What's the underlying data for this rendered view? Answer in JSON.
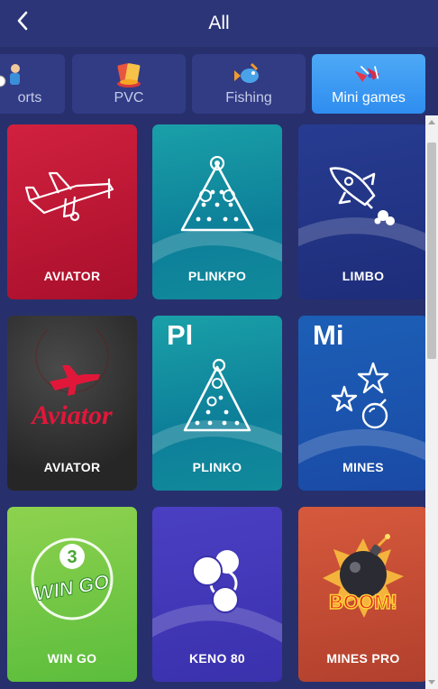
{
  "header": {
    "title": "All"
  },
  "tabs": [
    {
      "label": "orts",
      "icon": "sports-icon"
    },
    {
      "label": "PVC",
      "icon": "cards-chips-icon"
    },
    {
      "label": "Fishing",
      "icon": "fish-icon"
    },
    {
      "label": "Mini games",
      "icon": "planes-icon",
      "active": true
    }
  ],
  "games": [
    {
      "name": "AVIATOR",
      "icon": "plane-icon",
      "theme": "red"
    },
    {
      "name": "PLINKPO",
      "icon": "plinko-triangle-icon",
      "theme": "teal"
    },
    {
      "name": "LIMBO",
      "icon": "rocket-icon",
      "theme": "navy"
    },
    {
      "name": "AVIATOR",
      "icon": "aviator-logo-icon",
      "logo_text": "Aviator",
      "theme": "dark"
    },
    {
      "name": "PLINKO",
      "icon": "plinko-triangle-icon",
      "big": "Pl",
      "theme": "teal"
    },
    {
      "name": "MINES",
      "icon": "stars-bomb-icon",
      "big": "Mi",
      "theme": "blue"
    },
    {
      "name": "WIN GO",
      "icon": "wingo-ball-icon",
      "logo_number": "3",
      "logo_text": "WIN GO",
      "theme": "green"
    },
    {
      "name": "KENO 80",
      "icon": "keno-balls-icon",
      "theme": "purple"
    },
    {
      "name": "MINES PRO",
      "icon": "bomb-icon",
      "logo_text": "BOOM!",
      "theme": "orange"
    }
  ],
  "colors": {
    "background": "#27306d",
    "header": "#2c3577",
    "tab": "#313c85",
    "tab_active": "#3d9bf3"
  }
}
